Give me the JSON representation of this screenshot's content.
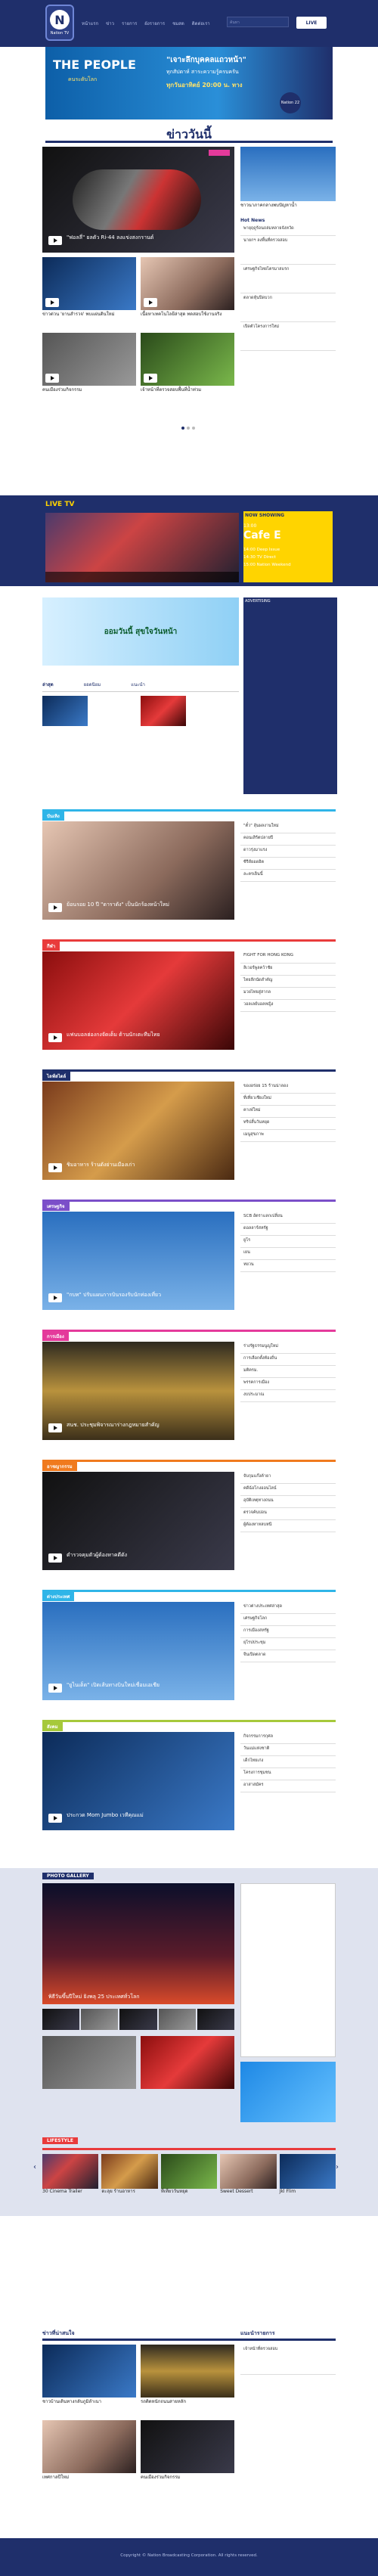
{
  "header": {
    "logo_text": "Nation TV",
    "nav": [
      "หน้าแรก",
      "ข่าว",
      "รายการ",
      "ผังรายการ",
      "ชมสด",
      "ติดต่อเรา"
    ],
    "search_placeholder": "ค้นหา",
    "live_label": "LIVE"
  },
  "banner": {
    "left": "THE PEOPLE",
    "left_sub": "คนระดับโลก",
    "headline": "\"เจาะลึกบุคคลแถวหน้า\"",
    "line2": "ทุกสัปดาห์ สาระความรู้ครบครัน",
    "line3": "ทุกวันอาทิตย์ 20:00 น. ทาง",
    "channel": "Nation 22"
  },
  "today": {
    "title": "ข่าววันนี้",
    "main_caption": "\"ฟอลลี่\" ยลตัว Ri-44 ลงแข่งสงกรานต์",
    "side_caption": "ชาวนาภาคกลางพบปัญหาน้ำ",
    "items": [
      "ข่าวด่วน 'ยานสำรวจ' พบแผ่นดินใหม่",
      "เนื้อหาเทคโนโลยีล่าสุด ทดสอบใช้งานจริง",
      "คนเมืองร่วมกิจกรรม",
      "เจ้าหน้าที่ตรวจสอบพื้นที่น้ำท่วม"
    ],
    "sidebar_title": "Hot News",
    "sidebar_items": [
      "พายุฤดูร้อนถล่มหลายจังหวัด",
      "นายกฯ ลงพื้นที่ตรวจสอบ",
      "เศรษฐกิจไทยไตรมาสแรก",
      "ตลาดหุ้นปิดบวก",
      "เปิดตัวโครงการใหม่"
    ]
  },
  "live": {
    "title": "LIVE TV",
    "now_showing": "NOW SHOWING",
    "time": "13:00",
    "program": "Cafe E",
    "schedule": [
      {
        "time": "14:00",
        "name": "Deep Issue"
      },
      {
        "time": "14:30",
        "name": "TV Direct"
      },
      {
        "time": "15:00",
        "name": "Nation Weekend"
      }
    ]
  },
  "ad": {
    "text": "ออมวันนี้ สุขใจวันหน้า",
    "side_title": "ADVERTISING"
  },
  "tabs": [
    "ล่าสุด",
    "ยอดนิยม",
    "แนะนำ"
  ],
  "sections": [
    {
      "label": "บันเทิง",
      "color": "#2fb5e8",
      "caption": "ย้อนรอย 10 ปี \"ดาราดัง\" เป็นนักร้องหน้าใหม่",
      "items": [
        "\"ตั๋ว\" ลุ้นผลงานใหม่",
        "คอนเสิร์ตปลายปี",
        "ดาวรุ่งมาแรง",
        "ซีรีส์ยอดฮิต",
        "ละครเย็นนี้"
      ]
    },
    {
      "label": "กีฬา",
      "color": "#e93b3b",
      "caption": "แฟนบอลฮ่องกงจัดเต็ม ต้านนักเตะทีมไทย",
      "items": [
        "FIGHT FOR HONG KONG",
        "ลิเวอร์พูลคว้าชัย",
        "ไทยลีกนัดสำคัญ",
        "มวยไทยสู่สากล",
        "วอลเลย์บอลหญิง"
      ]
    },
    {
      "label": "ไลฟ์สไตล์",
      "color": "#1f2f6b",
      "caption": "ชิมอาหาร ร้านดังย่านเมืองเก่า",
      "items": [
        "ของอร่อย 15 ร้านน่าลอง",
        "ที่เที่ยวเชียงใหม่",
        "คาเฟ่ใหม่",
        "ทริปสั้นวันหยุด",
        "เมนูสุขภาพ"
      ]
    },
    {
      "label": "เศรษฐกิจ",
      "color": "#7b4fc9",
      "caption": "\"กบท\" ปรับแผนการบินรองรับนักท่องเที่ยว",
      "items": [
        "SCB อัตราแลกเปลี่ยน",
        "ดอลลาร์สหรัฐ",
        "ยูโร",
        "เยน",
        "หยวน"
      ]
    },
    {
      "label": "การเมือง",
      "color": "#e43a9b",
      "caption": "สนช. ประชุมพิจารณาร่างกฎหมายสำคัญ",
      "items": [
        "ร่างรัฐธรรมนูญใหม่",
        "การเลือกตั้งท้องถิ่น",
        "มติครม.",
        "พรรคการเมือง",
        "งบประมาณ"
      ]
    },
    {
      "label": "อาชญากรรม",
      "color": "#f07a1e",
      "caption": "ตำรวจคุมตัวผู้ต้องหาคดีดัง",
      "items": [
        "จับกุมแก๊งค้ายา",
        "คดีฉ้อโกงออนไลน์",
        "อุบัติเหตุทางถนน",
        "ตรวจค้นบ่อน",
        "ผู้ต้องหาหลบหนี"
      ]
    },
    {
      "label": "ต่างประเทศ",
      "color": "#2fb5e8",
      "caption": "\"ยูไนเต็ด\" เปิดเส้นทางบินใหม่เชื่อมเอเชีย",
      "items": [
        "ข่าวต่างประเทศล่าสุด",
        "เศรษฐกิจโลก",
        "การเมืองสหรัฐ",
        "ยุโรปประชุม",
        "จีนเปิดตลาด"
      ]
    },
    {
      "label": "สังคม",
      "color": "#a6c93a",
      "caption": "ประกวด Mom Jumbo เวทีคุณแม่",
      "items": [
        "กิจกรรมการกุศล",
        "วันแม่แห่งชาติ",
        "เด็กไทยเก่ง",
        "โครงการชุมชน",
        "อาสาสมัคร"
      ]
    }
  ],
  "gallery": {
    "title": "PHOTO GALLERY",
    "caption": "พิธีวันขึ้นปีใหม่ ยิงพลุ 25 ประเทศทั่วโลก",
    "lifestyle_label": "LIFESTYLE",
    "lifestyle_items": [
      "30 Cinema Trailer",
      "ตะลุย ร้านอาหาร",
      "ที่เที่ยววันหยุด",
      "Sweet Dessert",
      "Jkl Flim"
    ]
  },
  "bottom": {
    "left_title": "ข่าวที่น่าสนใจ",
    "right_title": "แนะนำรายการ",
    "items": [
      "ชาวบ้านเดินทางกลับภูมิลำเนา",
      "รถติดหนักถนนสายหลัก",
      "เทศกาลปีใหม่",
      "คนเมืองร่วมกิจกรรม",
      "เจ้าหน้าที่ตรวจสอบ"
    ]
  },
  "footer": {
    "copyright": "Copyright © Nation Broadcasting Corporation. All rights reserved."
  }
}
